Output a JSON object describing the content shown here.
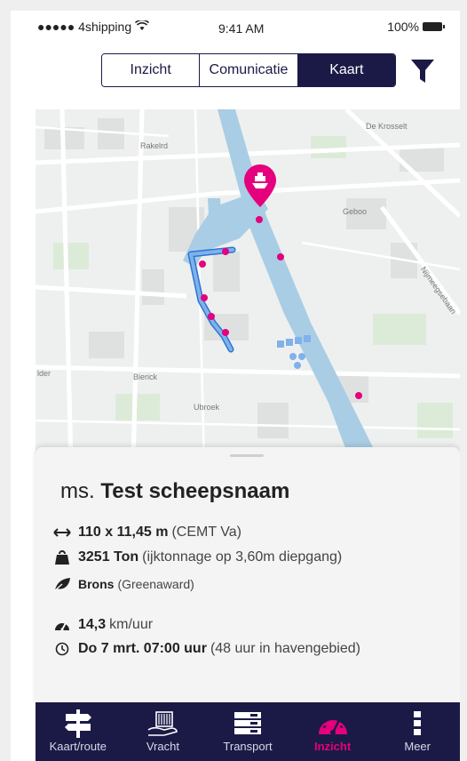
{
  "status_bar": {
    "carrier": "●●●●● 4shipping",
    "time": "9:41 AM",
    "battery": "100%"
  },
  "segments": [
    {
      "label": "Inzicht",
      "active": false
    },
    {
      "label": "Comunicatie",
      "active": false
    },
    {
      "label": "Kaart",
      "active": true
    }
  ],
  "filter_icon": "filter-funnel-icon",
  "map": {
    "labels": {
      "rakelrd": "Rakelrd",
      "de_krosselt": "De Krosselt",
      "gebou": "Geboo",
      "nijmeegsebaan": "Nijmeegsebaan",
      "bierick": "Bierick",
      "ubroek": "Ubroek",
      "lder": "lder"
    },
    "accent_color": "#e5007d",
    "water_color": "#a9cde4"
  },
  "ship": {
    "prefix": "ms.",
    "name": "Test scheepsnaam",
    "dimensions": "110 x 11,45 m",
    "dimensions_note": "(CEMT Va)",
    "tonnage": "3251 Ton",
    "tonnage_note": "(ijktonnage op 3,60m diepgang)",
    "award": "Brons",
    "award_note": "(Greenaward)",
    "speed": "14,3",
    "speed_unit": "km/uur",
    "eta": "Do 7 mrt. 07:00 uur",
    "eta_note": "(48 uur in havengebied)"
  },
  "tabs": [
    {
      "label": "Kaart/route",
      "icon": "signpost-icon",
      "active": false
    },
    {
      "label": "Vracht",
      "icon": "cargo-hand-icon",
      "active": false
    },
    {
      "label": "Transport",
      "icon": "transport-list-icon",
      "active": false
    },
    {
      "label": "Inzicht",
      "icon": "speedometer-icon",
      "active": true
    },
    {
      "label": "Meer",
      "icon": "more-dots-icon",
      "active": false
    }
  ],
  "colors": {
    "navy": "#1b1a47",
    "accent": "#e5007d"
  }
}
